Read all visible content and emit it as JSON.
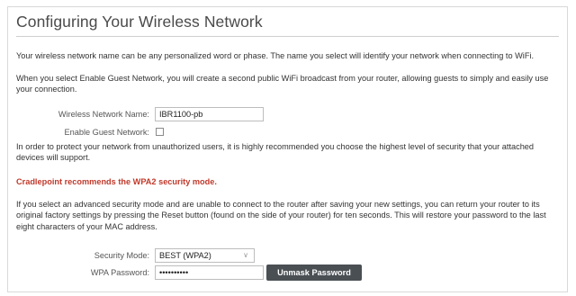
{
  "page": {
    "title": "Configuring Your Wireless Network",
    "intro1": "Your wireless network name can be any personalized word or phase. The name you select will identify your network when connecting to WiFi.",
    "intro2": "When you select Enable Guest Network, you will create a second public WiFi broadcast from your router, allowing guests to simply and easily use your connection."
  },
  "form": {
    "ssid_label": "Wireless Network Name:",
    "ssid_value": "IBR1100-pb",
    "guest_label": "Enable Guest Network:",
    "guest_checked": false,
    "security_note": "In order to protect your network from unauthorized users, it is highly recommended you choose the highest level of security that your attached devices will support.",
    "recommendation": "Cradlepoint recommends the WPA2 security mode.",
    "reset_note": "If you select an advanced security mode and are unable to connect to the router after saving your new settings, you can return your router to its original factory settings by pressing the Reset button (found on the side of your router) for ten seconds. This will restore your password to the last eight characters of your MAC address.",
    "mode_label": "Security Mode:",
    "mode_value": "BEST (WPA2)",
    "password_label": "WPA Password:",
    "password_value": "••••••••••",
    "unmask_label": "Unmask Password"
  },
  "colors": {
    "accent_red": "#c0392b",
    "button_bg": "#4a4f54"
  }
}
